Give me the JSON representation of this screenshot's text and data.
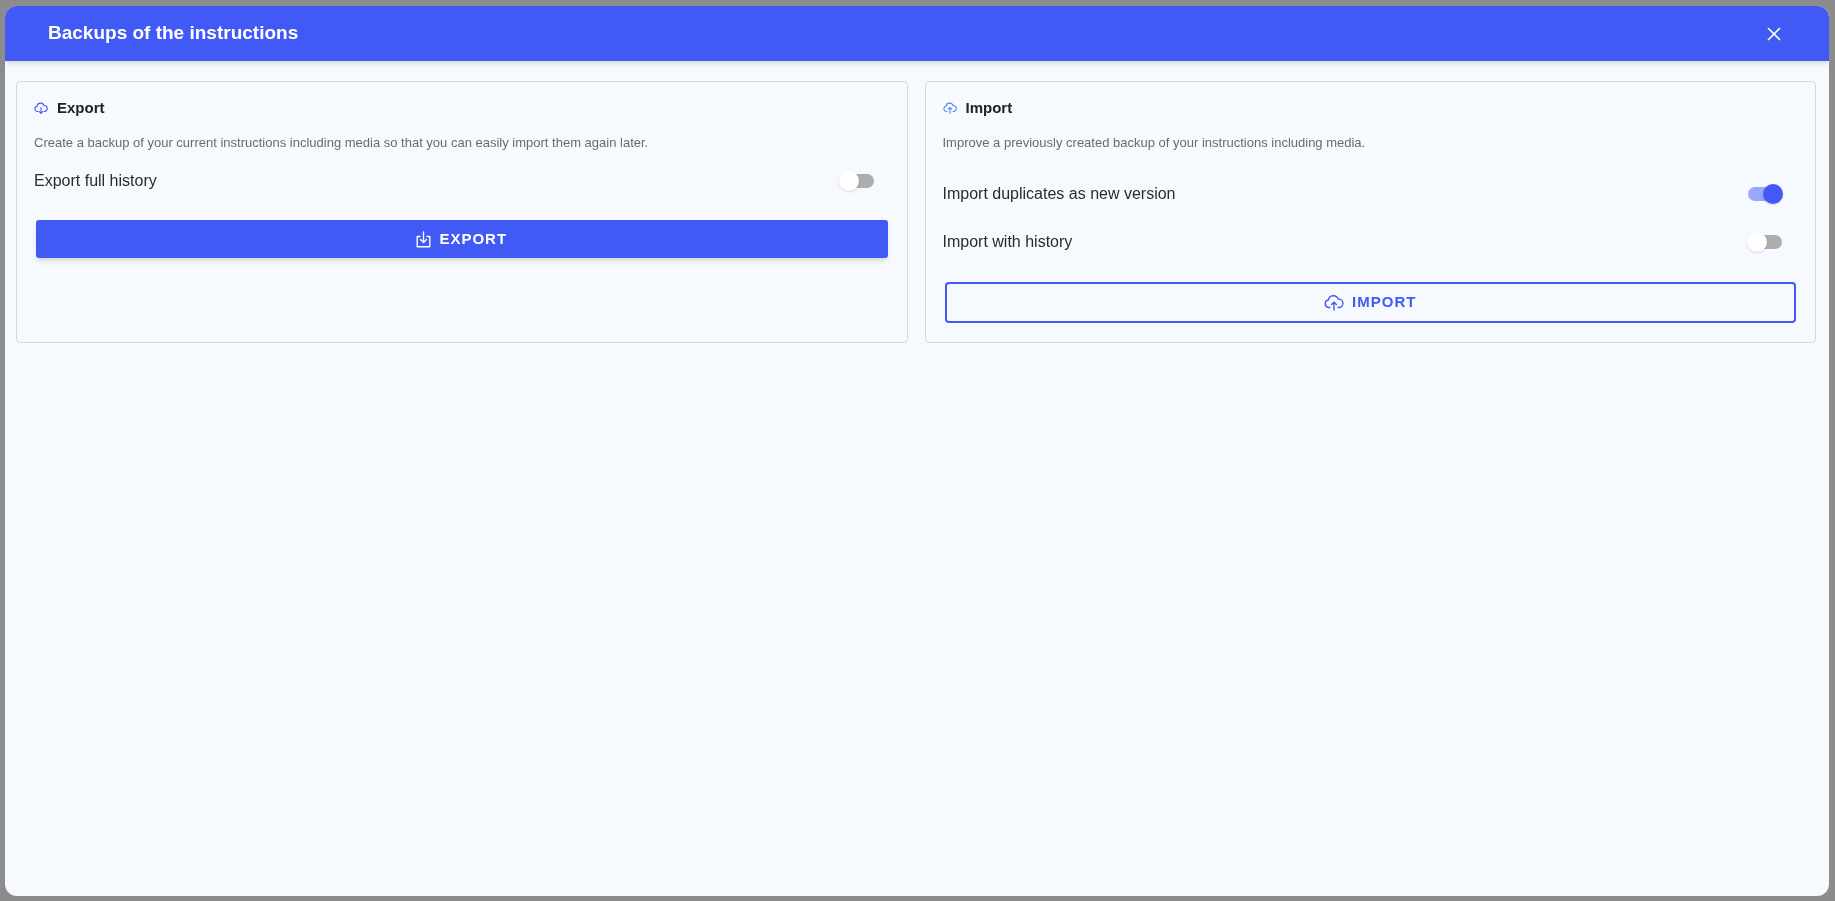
{
  "dialog": {
    "title": "Backups of the instructions"
  },
  "panels": [
    {
      "kind": "export",
      "title": "Export",
      "description": "Create a backup of your current instructions including media so that you can easily import them again later.",
      "options": [
        {
          "label": "Export full history",
          "on": false
        }
      ],
      "button": {
        "label": "EXPORT"
      }
    },
    {
      "kind": "import",
      "title": "Import",
      "description": "Improve a previously created backup of your instructions including media.",
      "options": [
        {
          "label": "Import duplicates as new version",
          "on": true
        },
        {
          "label": "Import with history",
          "on": false
        }
      ],
      "button": {
        "label": "IMPORT"
      }
    }
  ]
}
